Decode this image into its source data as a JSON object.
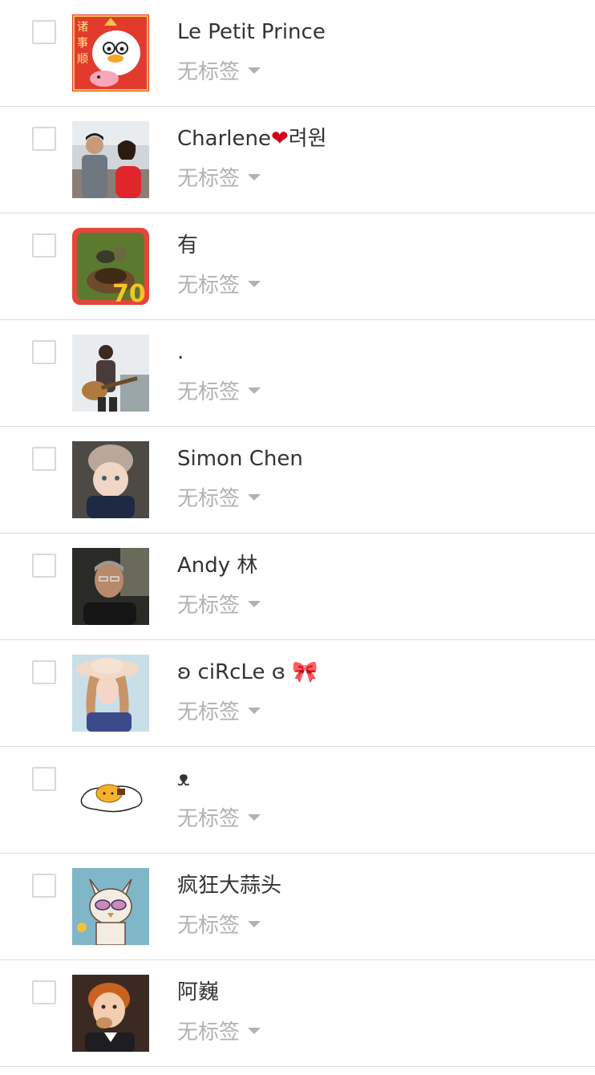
{
  "contacts": [
    {
      "name": "Le Petit Prince",
      "tag_label": "无标签",
      "avatar": "duck-pig-cartoon-avatar"
    },
    {
      "name": "Charlene",
      "name_emoji": "❤",
      "name_suffix": "려원",
      "tag_label": "无标签",
      "avatar": "couple-photo-avatar"
    },
    {
      "name": "有",
      "tag_label": "无标签",
      "avatar": "bird-nest-avatar"
    },
    {
      "name": ".",
      "tag_label": "无标签",
      "avatar": "guitar-player-avatar"
    },
    {
      "name": "Simon Chen",
      "tag_label": "无标签",
      "avatar": "baby-beanie-avatar"
    },
    {
      "name": "Andy 林",
      "tag_label": "无标签",
      "avatar": "older-man-avatar"
    },
    {
      "name": "ʚ ciRcLe ɞ ",
      "name_emoji": "🎀",
      "tag_label": "无标签",
      "avatar": "woman-sunhat-avatar"
    },
    {
      "name": "ᴥ",
      "tag_label": "无标签",
      "avatar": "lazy-egg-avatar"
    },
    {
      "name": "疯狂大蒜头",
      "tag_label": "无标签",
      "avatar": "cat-mask-drawing-avatar"
    },
    {
      "name": "阿巍",
      "tag_label": "无标签",
      "avatar": "boy-eating-avatar"
    }
  ],
  "colors": {
    "name_text": "#333333",
    "tag_text": "#b2b2b2",
    "divider": "#dcdcdc",
    "checkbox_border": "#d9d9d9"
  }
}
